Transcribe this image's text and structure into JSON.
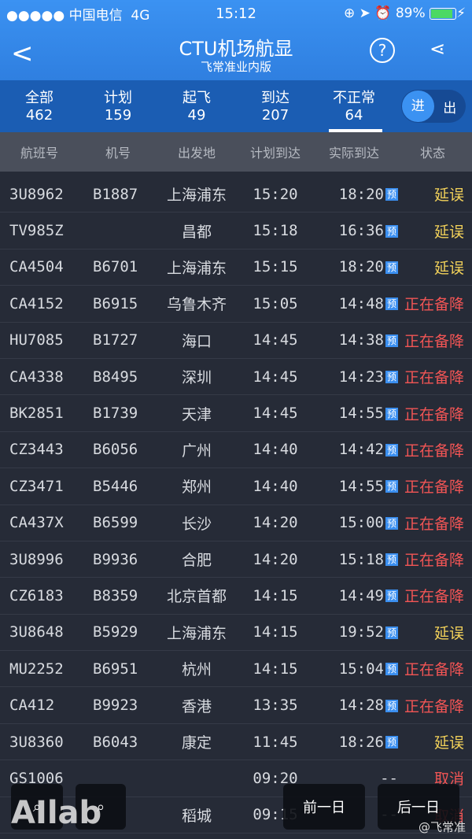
{
  "status_bar": {
    "carrier": "●●●●● 中国电信",
    "network": "4G",
    "time": "15:12",
    "icons": "⊕ ➤ ⏰",
    "battery": "89%"
  },
  "header": {
    "title": "CTU机场航显",
    "subtitle": "飞常准业内版",
    "help": "?",
    "share": "share-icon",
    "back": "back-icon"
  },
  "tabs": [
    {
      "label": "全部",
      "count": "462"
    },
    {
      "label": "计划",
      "count": "159"
    },
    {
      "label": "起飞",
      "count": "49"
    },
    {
      "label": "到达",
      "count": "207"
    },
    {
      "label": "不正常",
      "count": "64",
      "active": true
    }
  ],
  "toggle": {
    "in": "进",
    "out": "出",
    "selected": "进"
  },
  "columns": [
    "航班号",
    "机号",
    "出发地",
    "计划到达",
    "实际到达",
    "状态"
  ],
  "badge": "预",
  "colors": {
    "delay": "#f3d25a",
    "divert": "#f25555",
    "accent": "#3b92f2"
  },
  "rows": [
    [
      "3U8962",
      "B1887",
      "上海浦东",
      "15:20",
      "18:20",
      "延误"
    ],
    [
      "TV985Z",
      "",
      "昌都",
      "15:18",
      "16:36",
      "延误"
    ],
    [
      "CA4504",
      "B6701",
      "上海浦东",
      "15:15",
      "18:20",
      "延误"
    ],
    [
      "CA4152",
      "B6915",
      "乌鲁木齐",
      "15:05",
      "14:48",
      "正在备降"
    ],
    [
      "HU7085",
      "B1727",
      "海口",
      "14:45",
      "14:38",
      "正在备降"
    ],
    [
      "CA4338",
      "B8495",
      "深圳",
      "14:45",
      "14:23",
      "正在备降"
    ],
    [
      "BK2851",
      "B1739",
      "天津",
      "14:45",
      "14:55",
      "正在备降"
    ],
    [
      "CZ3443",
      "B6056",
      "广州",
      "14:40",
      "14:42",
      "正在备降"
    ],
    [
      "CZ3471",
      "B5446",
      "郑州",
      "14:40",
      "14:55",
      "正在备降"
    ],
    [
      "CA437X",
      "B6599",
      "长沙",
      "14:20",
      "15:00",
      "正在备降"
    ],
    [
      "3U8996",
      "B9936",
      "合肥",
      "14:20",
      "15:18",
      "正在备降"
    ],
    [
      "CZ6183",
      "B8359",
      "北京首都",
      "14:15",
      "14:49",
      "正在备降"
    ],
    [
      "3U8648",
      "B5929",
      "上海浦东",
      "14:15",
      "19:52",
      "延误"
    ],
    [
      "MU2252",
      "B6951",
      "杭州",
      "14:15",
      "15:04",
      "正在备降"
    ],
    [
      "CA412",
      "B9923",
      "香港",
      "13:35",
      "14:28",
      "正在备降"
    ],
    [
      "3U8360",
      "B6043",
      "康定",
      "11:45",
      "18:26",
      "延误"
    ],
    [
      "GS1006",
      "",
      "",
      "09:20",
      "--",
      "取消"
    ],
    [
      "",
      "",
      "稻城",
      "09:15",
      "--",
      "取消"
    ]
  ],
  "footer": {
    "prev_day": "前一日",
    "next_day": "后一日"
  },
  "watermark": "AIlab  .CN",
  "weibo": "@飞常准"
}
